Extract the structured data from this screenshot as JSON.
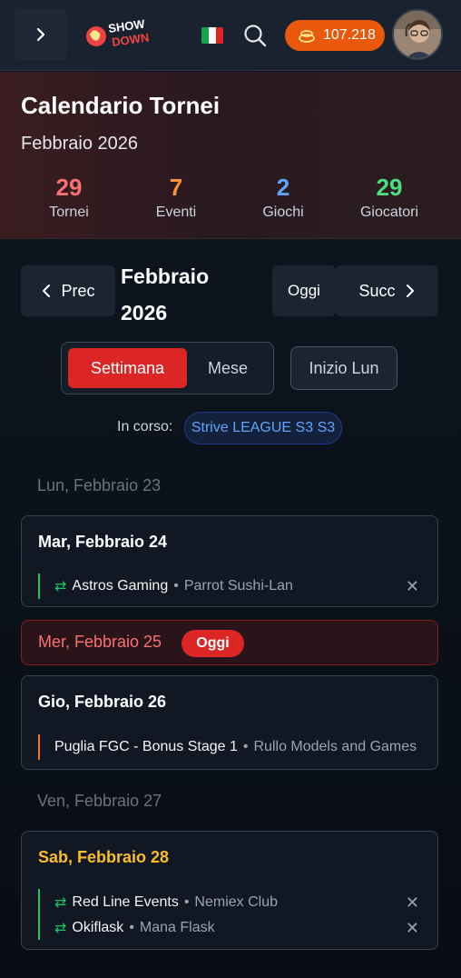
{
  "topnav": {
    "coins": "107.218",
    "colors": {
      "coins_bg": "#ea580c",
      "bar_bg": "#1a2230"
    }
  },
  "header": {
    "title": "Calendario Tornei",
    "subtitle": "Febbraio 2026",
    "stats": [
      {
        "value": "29",
        "label": "Tornei",
        "color": "#f87171"
      },
      {
        "value": "7",
        "label": "Eventi",
        "color": "#fb923c"
      },
      {
        "value": "2",
        "label": "Giochi",
        "color": "#60a5fa"
      },
      {
        "value": "29",
        "label": "Giocatori",
        "color": "#4ade80"
      }
    ]
  },
  "nav": {
    "prev_label": "Prec",
    "month_label": "Febbraio 2026",
    "today_label": "Oggi",
    "next_label": "Succ",
    "view_week": "Settimana",
    "view_month": "Mese",
    "start_day": "Inizio Lun"
  },
  "ongoing": {
    "label": "In corso:",
    "badge": "Strive LEAGUE S3 S3"
  },
  "days": [
    {
      "label": "Lun, Febbraio 23"
    },
    {
      "label": "Mar, Febbraio 24",
      "events": [
        {
          "name": "Astros Gaming",
          "venue": "Parrot Sushi-Lan"
        }
      ]
    },
    {
      "label": "Mer, Febbraio 25",
      "badge": "Oggi"
    },
    {
      "label": "Gio, Febbraio 26",
      "events": [
        {
          "name": "Puglia FGC - Bonus Stage 1",
          "venue": "Rullo Models and Games"
        }
      ]
    },
    {
      "label": "Ven, Febbraio 27"
    },
    {
      "label": "Sab, Febbraio 28",
      "events": [
        {
          "name": "Red Line Events",
          "venue": "Nemiex Club"
        },
        {
          "name": "Okiflask",
          "venue": "Mana Flask"
        }
      ]
    }
  ],
  "icons": {
    "menu": "chevron-right-icon",
    "search": "search-icon",
    "coin": "coin-icon",
    "sync": "sync-icon",
    "close": "close-icon",
    "flag": "italy-flag-icon"
  }
}
